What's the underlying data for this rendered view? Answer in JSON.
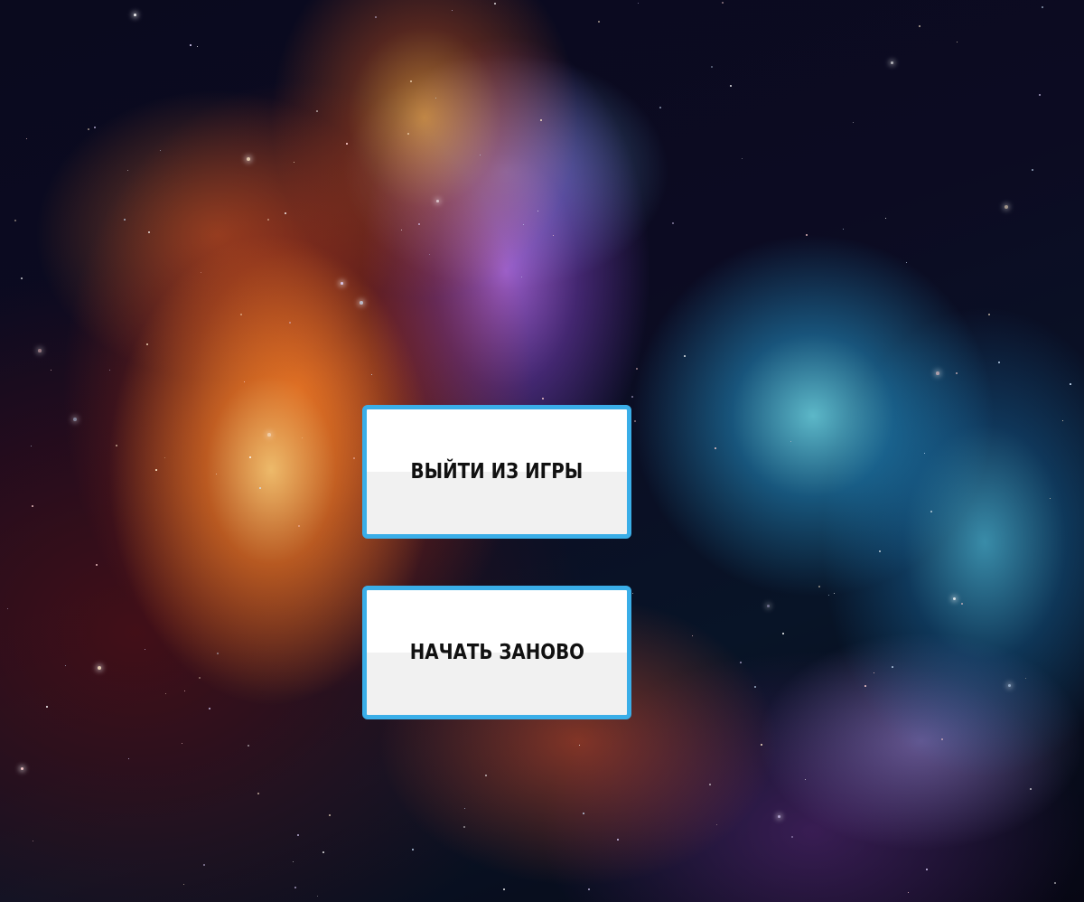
{
  "background": {
    "description_icon": "space-nebula-image"
  },
  "menu": {
    "exit_label": "ВЫЙТИ ИЗ ИГРЫ",
    "restart_label": "НАЧАТЬ ЗАНОВО"
  },
  "colors": {
    "button_border": "#3aaee8",
    "button_fill": "#ffffff",
    "label_text": "#111111"
  }
}
